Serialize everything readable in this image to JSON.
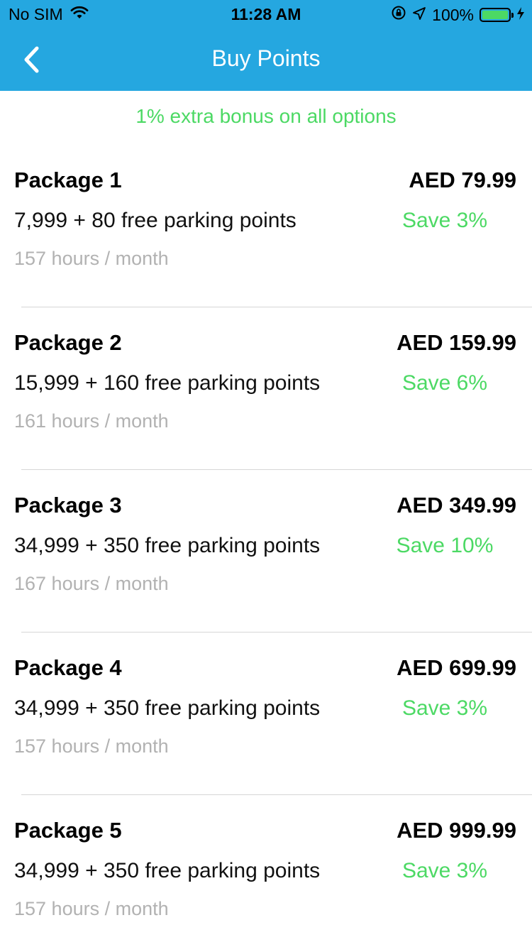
{
  "status_bar": {
    "carrier": "No SIM",
    "time": "11:28 AM",
    "battery": "100%",
    "battery_level": 1.0,
    "icons": [
      "wifi-icon",
      "orientation-lock-icon",
      "location-arrow-icon",
      "battery-icon",
      "charging-bolt-icon"
    ]
  },
  "nav": {
    "title": "Buy Points",
    "back_icon": "chevron-left-icon"
  },
  "colors": {
    "header_bg": "#25a7e0",
    "accent_green": "#4cd964",
    "hours_gray": "#b2b2b2"
  },
  "bonus_text": "1% extra bonus on all options",
  "packages": [
    {
      "name": "Package 1",
      "price": "AED 79.99",
      "points": "7,999 + 80 free parking points",
      "save": "Save 3%",
      "hours": "157 hours / month"
    },
    {
      "name": "Package 2",
      "price": "AED 159.99",
      "points": "15,999 + 160 free parking points",
      "save": "Save 6%",
      "hours": "161 hours / month"
    },
    {
      "name": "Package 3",
      "price": "AED 349.99",
      "points": "34,999 + 350 free parking points",
      "save": "Save 10%",
      "hours": "167 hours / month"
    },
    {
      "name": "Package 4",
      "price": "AED 699.99",
      "points": "34,999 + 350 free parking points",
      "save": "Save 3%",
      "hours": "157 hours / month"
    },
    {
      "name": "Package 5",
      "price": "AED 999.99",
      "points": "34,999 + 350 free parking points",
      "save": "Save 3%",
      "hours": "157 hours / month"
    }
  ]
}
